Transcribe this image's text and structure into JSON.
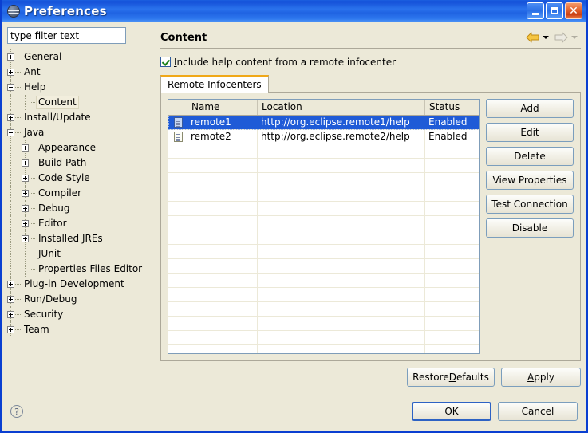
{
  "window": {
    "title": "Preferences",
    "icon": "eclipse-icon",
    "controls": {
      "minimize": "minimize",
      "maximize": "maximize",
      "close": "close"
    },
    "border_color": "#0a3fd1",
    "titlebar_color": "#2a72ec",
    "background_color": "#ece9d8"
  },
  "sidebar": {
    "filter": {
      "value": "type filter text",
      "placeholder": "type filter text"
    },
    "items": [
      {
        "label": "General",
        "level": 1,
        "state": "collapsed",
        "selected": false
      },
      {
        "label": "Ant",
        "level": 1,
        "state": "collapsed",
        "selected": false
      },
      {
        "label": "Help",
        "level": 1,
        "state": "expanded",
        "selected": false
      },
      {
        "label": "Content",
        "level": 2,
        "state": "leaf",
        "selected": true
      },
      {
        "label": "Install/Update",
        "level": 1,
        "state": "collapsed",
        "selected": false
      },
      {
        "label": "Java",
        "level": 1,
        "state": "expanded",
        "selected": false
      },
      {
        "label": "Appearance",
        "level": 2,
        "state": "collapsed",
        "selected": false
      },
      {
        "label": "Build Path",
        "level": 2,
        "state": "collapsed",
        "selected": false
      },
      {
        "label": "Code Style",
        "level": 2,
        "state": "collapsed",
        "selected": false
      },
      {
        "label": "Compiler",
        "level": 2,
        "state": "collapsed",
        "selected": false
      },
      {
        "label": "Debug",
        "level": 2,
        "state": "collapsed",
        "selected": false
      },
      {
        "label": "Editor",
        "level": 2,
        "state": "collapsed",
        "selected": false
      },
      {
        "label": "Installed JREs",
        "level": 2,
        "state": "collapsed",
        "selected": false
      },
      {
        "label": "JUnit",
        "level": 2,
        "state": "leaf",
        "selected": false
      },
      {
        "label": "Properties Files Editor",
        "level": 2,
        "state": "leaf",
        "selected": false
      },
      {
        "label": "Plug-in Development",
        "level": 1,
        "state": "collapsed",
        "selected": false
      },
      {
        "label": "Run/Debug",
        "level": 1,
        "state": "collapsed",
        "selected": false
      },
      {
        "label": "Security",
        "level": 1,
        "state": "collapsed",
        "selected": false
      },
      {
        "label": "Team",
        "level": 1,
        "state": "collapsed",
        "selected": false
      }
    ]
  },
  "page": {
    "title": "Content",
    "nav": {
      "back": "back-arrow",
      "back_enabled": true,
      "forward": "forward-arrow",
      "forward_enabled": false
    },
    "checkbox": {
      "checked": true,
      "mnemonic": "I",
      "label_rest": "nclude help content from a remote infocenter"
    },
    "tabs": [
      {
        "label": "Remote Infocenters",
        "active": true
      }
    ],
    "table": {
      "columns": [
        "",
        "Name",
        "Location",
        "Status"
      ],
      "rows": [
        {
          "icon": "document-icon",
          "name": "remote1",
          "location": "http://org.eclipse.remote1/help",
          "status": "Enabled",
          "selected": true
        },
        {
          "icon": "document-icon",
          "name": "remote2",
          "location": "http://org.eclipse.remote2/help",
          "status": "Enabled",
          "selected": false
        }
      ],
      "empty_rows": 15
    },
    "side_buttons": [
      {
        "label": "Add"
      },
      {
        "label": "Edit"
      },
      {
        "label": "Delete"
      },
      {
        "label": "View Properties"
      },
      {
        "label": "Test Connection"
      },
      {
        "label": "Disable"
      }
    ],
    "restore_defaults": {
      "pre": "Restore ",
      "mnemonic": "D",
      "post": "efaults"
    },
    "apply": {
      "mnemonic": "A",
      "post": "pply"
    }
  },
  "footer": {
    "help": "help-icon",
    "ok": "OK",
    "cancel": "Cancel"
  }
}
